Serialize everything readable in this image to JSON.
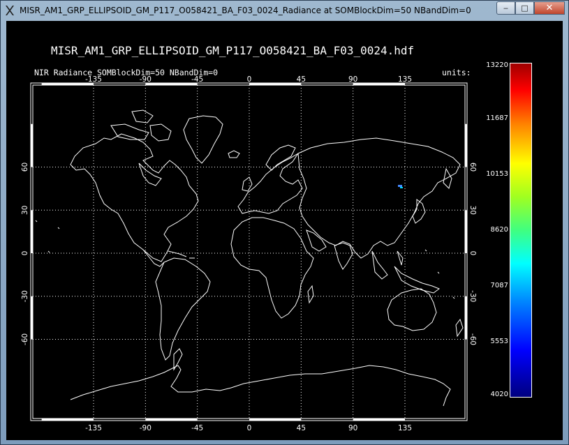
{
  "window": {
    "title": "MISR_AM1_GRP_ELLIPSOID_GM_P117_O058421_BA_F03_0024_Radiance at SOMBlockDim=50 NBandDim=0",
    "minimize_glyph": "‒",
    "maximize_glyph": "□",
    "close_glyph": "✕",
    "icon": "x11-icon"
  },
  "plot": {
    "title": "MISR_AM1_GRP_ELLIPSOID_GM_P117_O058421_BA_F03_0024.hdf",
    "subtitle": "NIR Radiance SOMBlockDim=50 NBandDim=0",
    "units_label": "units:",
    "lon_ticks": [
      "-135",
      "-90",
      "-45",
      "0",
      "45",
      "90",
      "135"
    ],
    "lat_ticks": [
      "60",
      "30",
      "0",
      "-30",
      "-60"
    ],
    "lon_values": [
      -135,
      -90,
      -45,
      0,
      45,
      90,
      135
    ],
    "lat_values": [
      60,
      30,
      0,
      -30,
      -60
    ],
    "colors": {
      "background": "#000000",
      "coastline": "#ffffff",
      "data_swath": "#4488ff"
    }
  },
  "colorbar": {
    "labels": [
      "13220",
      "11687",
      "10153",
      "8620",
      "7087",
      "5553",
      "4020"
    ],
    "min": 4020,
    "max": 13220
  }
}
